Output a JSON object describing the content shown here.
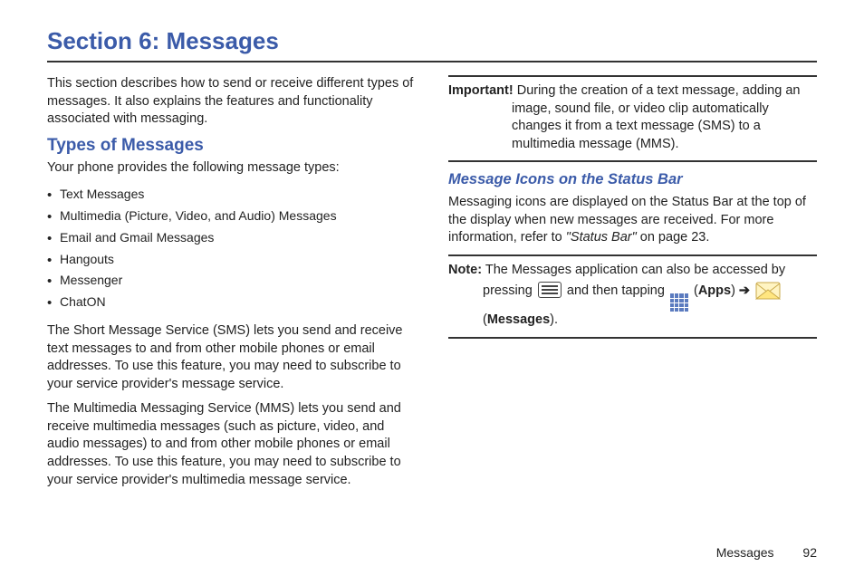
{
  "section_title": "Section 6: Messages",
  "intro": "This section describes how to send or receive different types of messages. It also explains the features and functionality associated with messaging.",
  "types_heading": "Types of Messages",
  "types_intro": "Your phone provides the following message types:",
  "message_types": [
    "Text Messages",
    "Multimedia (Picture, Video, and Audio) Messages",
    "Email and Gmail Messages",
    "Hangouts",
    "Messenger",
    "ChatON"
  ],
  "sms_para": "The Short Message Service (SMS) lets you send and receive text messages to and from other mobile phones or email addresses. To use this feature, you may need to subscribe to your service provider's message service.",
  "mms_para": "The Multimedia Messaging Service (MMS) lets you send and receive multimedia messages (such as picture, video, and audio messages) to and from other mobile phones or email addresses. To use this feature, you may need to subscribe to your service provider's multimedia message service.",
  "important": {
    "label": "Important!",
    "text_line1": "During the creation of a text message, adding an",
    "text_rest": "image, sound file, or video clip automatically changes it from a text message (SMS) to a multimedia message (MMS)."
  },
  "status_bar_heading": "Message Icons on the Status Bar",
  "status_bar_text_a": "Messaging icons are displayed on the Status Bar at the top of the display when new messages are received. For more information, refer to ",
  "status_bar_ref": "\"Status Bar\"",
  "status_bar_text_b": " on page 23.",
  "note": {
    "label": "Note:",
    "line1": "The Messages application can also be accessed by",
    "pressing": "pressing",
    "and_then": " and then tapping ",
    "apps": "Apps",
    "arrow": "➔",
    "messages": "Messages"
  },
  "footer": {
    "label": "Messages",
    "page": "92"
  }
}
